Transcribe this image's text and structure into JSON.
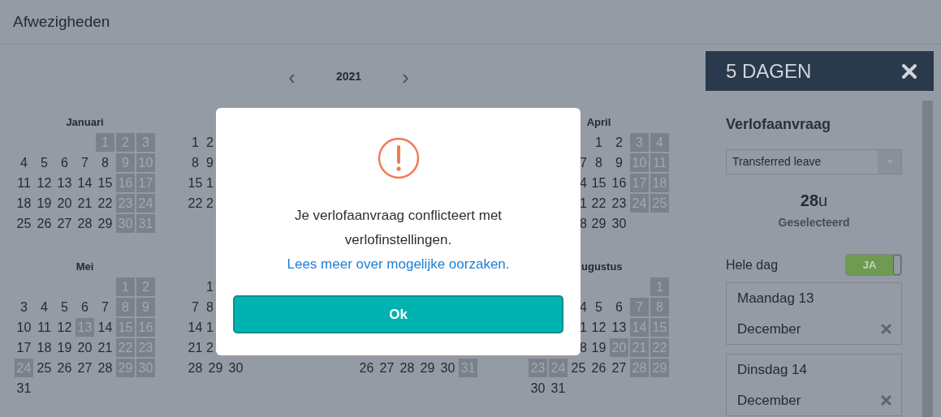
{
  "page": {
    "title": "Afwezigheden"
  },
  "year_nav": {
    "prev": "‹",
    "year": "2021",
    "next": "›"
  },
  "months": [
    {
      "title": "Januari",
      "title_cut": false,
      "weeks": [
        [
          {
            "kind": "blank"
          },
          {
            "kind": "blank"
          },
          {
            "kind": "blank"
          },
          {
            "kind": "blank"
          },
          {
            "kind": "day",
            "day": "1",
            "shaded": true
          },
          {
            "kind": "day",
            "day": "2",
            "shaded": true
          },
          {
            "kind": "day",
            "day": "3",
            "shaded": true
          }
        ],
        [
          {
            "kind": "day",
            "day": "4",
            "shaded": false
          },
          {
            "kind": "day",
            "day": "5",
            "shaded": false
          },
          {
            "kind": "day",
            "day": "6",
            "shaded": false
          },
          {
            "kind": "day",
            "day": "7",
            "shaded": false
          },
          {
            "kind": "day",
            "day": "8",
            "shaded": false
          },
          {
            "kind": "day",
            "day": "9",
            "shaded": true
          },
          {
            "kind": "day",
            "day": "10",
            "shaded": true
          }
        ],
        [
          {
            "kind": "day",
            "day": "11",
            "shaded": false
          },
          {
            "kind": "day",
            "day": "12",
            "shaded": false
          },
          {
            "kind": "day",
            "day": "13",
            "shaded": false
          },
          {
            "kind": "day",
            "day": "14",
            "shaded": false
          },
          {
            "kind": "day",
            "day": "15",
            "shaded": false
          },
          {
            "kind": "day",
            "day": "16",
            "shaded": true
          },
          {
            "kind": "day",
            "day": "17",
            "shaded": true
          }
        ],
        [
          {
            "kind": "day",
            "day": "18",
            "shaded": false
          },
          {
            "kind": "day",
            "day": "19",
            "shaded": false
          },
          {
            "kind": "day",
            "day": "20",
            "shaded": false
          },
          {
            "kind": "day",
            "day": "21",
            "shaded": false
          },
          {
            "kind": "day",
            "day": "22",
            "shaded": false
          },
          {
            "kind": "day",
            "day": "23",
            "shaded": true
          },
          {
            "kind": "day",
            "day": "24",
            "shaded": true
          }
        ],
        [
          {
            "kind": "day",
            "day": "25",
            "shaded": false
          },
          {
            "kind": "day",
            "day": "26",
            "shaded": false
          },
          {
            "kind": "day",
            "day": "27",
            "shaded": false
          },
          {
            "kind": "day",
            "day": "28",
            "shaded": false
          },
          {
            "kind": "day",
            "day": "29",
            "shaded": false
          },
          {
            "kind": "day",
            "day": "30",
            "shaded": true
          },
          {
            "kind": "day",
            "day": "31",
            "shaded": true
          }
        ]
      ]
    },
    {
      "weeks": [
        [
          {
            "kind": "day",
            "day": "1",
            "shaded": false
          },
          {
            "kind": "cut_start",
            "day": "2",
            "shaded": false
          }
        ],
        [
          {
            "kind": "day",
            "day": "8",
            "shaded": false
          },
          {
            "kind": "cut_start",
            "day": "9",
            "shaded": false
          }
        ],
        [
          {
            "kind": "day",
            "day": "15",
            "shaded": false
          },
          {
            "kind": "cut_start",
            "day": "1",
            "shaded": false
          }
        ],
        [
          {
            "kind": "day",
            "day": "22",
            "shaded": false
          },
          {
            "kind": "cut_start",
            "day": "2",
            "shaded": false
          }
        ]
      ]
    },
    {
      "kind": "covered"
    },
    {
      "title": "April",
      "title_cut": false,
      "weeks": [
        [
          {
            "kind": "blank"
          },
          {
            "kind": "blank"
          },
          {
            "kind": "blank"
          },
          {
            "kind": "day",
            "day": "1",
            "shaded": false
          },
          {
            "kind": "day",
            "day": "2",
            "shaded": false
          },
          {
            "kind": "day",
            "day": "3",
            "shaded": true
          },
          {
            "kind": "day",
            "day": "4",
            "shaded": true
          }
        ],
        [
          {
            "kind": "blank"
          },
          {
            "kind": "blank"
          },
          {
            "kind": "cut_end",
            "day": "7",
            "shaded": false
          },
          {
            "kind": "day",
            "day": "8",
            "shaded": false
          },
          {
            "kind": "day",
            "day": "9",
            "shaded": false
          },
          {
            "kind": "day",
            "day": "10",
            "shaded": true
          },
          {
            "kind": "day",
            "day": "11",
            "shaded": true
          }
        ],
        [
          {
            "kind": "blank"
          },
          {
            "kind": "blank"
          },
          {
            "kind": "cut_end",
            "day": "4",
            "shaded": false
          },
          {
            "kind": "day",
            "day": "15",
            "shaded": false
          },
          {
            "kind": "day",
            "day": "16",
            "shaded": false
          },
          {
            "kind": "day",
            "day": "17",
            "shaded": true
          },
          {
            "kind": "day",
            "day": "18",
            "shaded": true
          }
        ],
        [
          {
            "kind": "blank"
          },
          {
            "kind": "blank"
          },
          {
            "kind": "cut_end",
            "day": "1",
            "shaded": false
          },
          {
            "kind": "day",
            "day": "22",
            "shaded": false
          },
          {
            "kind": "day",
            "day": "23",
            "shaded": false
          },
          {
            "kind": "day",
            "day": "24",
            "shaded": true
          },
          {
            "kind": "day",
            "day": "25",
            "shaded": true
          }
        ],
        [
          {
            "kind": "blank"
          },
          {
            "kind": "blank"
          },
          {
            "kind": "cut_end",
            "day": "8",
            "shaded": false
          },
          {
            "kind": "day",
            "day": "29",
            "shaded": false
          },
          {
            "kind": "day",
            "day": "30",
            "shaded": false
          }
        ]
      ]
    },
    {
      "title": "Mei",
      "title_cut": false,
      "weeks": [
        [
          {
            "kind": "blank"
          },
          {
            "kind": "blank"
          },
          {
            "kind": "blank"
          },
          {
            "kind": "blank"
          },
          {
            "kind": "blank"
          },
          {
            "kind": "day",
            "day": "1",
            "shaded": true
          },
          {
            "kind": "day",
            "day": "2",
            "shaded": true
          }
        ],
        [
          {
            "kind": "day",
            "day": "3",
            "shaded": false
          },
          {
            "kind": "day",
            "day": "4",
            "shaded": false
          },
          {
            "kind": "day",
            "day": "5",
            "shaded": false
          },
          {
            "kind": "day",
            "day": "6",
            "shaded": false
          },
          {
            "kind": "day",
            "day": "7",
            "shaded": false
          },
          {
            "kind": "day",
            "day": "8",
            "shaded": true
          },
          {
            "kind": "day",
            "day": "9",
            "shaded": true
          }
        ],
        [
          {
            "kind": "day",
            "day": "10",
            "shaded": false
          },
          {
            "kind": "day",
            "day": "11",
            "shaded": false
          },
          {
            "kind": "day",
            "day": "12",
            "shaded": false
          },
          {
            "kind": "day",
            "day": "13",
            "shaded": true
          },
          {
            "kind": "day",
            "day": "14",
            "shaded": false
          },
          {
            "kind": "day",
            "day": "15",
            "shaded": true
          },
          {
            "kind": "day",
            "day": "16",
            "shaded": true
          }
        ],
        [
          {
            "kind": "day",
            "day": "17",
            "shaded": false
          },
          {
            "kind": "day",
            "day": "18",
            "shaded": false
          },
          {
            "kind": "day",
            "day": "19",
            "shaded": false
          },
          {
            "kind": "day",
            "day": "20",
            "shaded": false
          },
          {
            "kind": "day",
            "day": "21",
            "shaded": false
          },
          {
            "kind": "day",
            "day": "22",
            "shaded": true
          },
          {
            "kind": "day",
            "day": "23",
            "shaded": true
          }
        ],
        [
          {
            "kind": "day",
            "day": "24",
            "shaded": true
          },
          {
            "kind": "day",
            "day": "25",
            "shaded": false
          },
          {
            "kind": "day",
            "day": "26",
            "shaded": false
          },
          {
            "kind": "day",
            "day": "27",
            "shaded": false
          },
          {
            "kind": "day",
            "day": "28",
            "shaded": false
          },
          {
            "kind": "day",
            "day": "29",
            "shaded": true
          },
          {
            "kind": "day",
            "day": "30",
            "shaded": true
          }
        ],
        [
          {
            "kind": "day",
            "day": "31",
            "shaded": false
          }
        ]
      ]
    },
    {
      "weeks": [
        [
          {
            "kind": "blank"
          },
          {
            "kind": "cut_start",
            "day": "1",
            "shaded": false
          }
        ],
        [
          {
            "kind": "day",
            "day": "7",
            "shaded": false
          },
          {
            "kind": "cut_start",
            "day": "8",
            "shaded": false
          }
        ],
        [
          {
            "kind": "day",
            "day": "14",
            "shaded": false
          },
          {
            "kind": "cut_start",
            "day": "1",
            "shaded": false
          }
        ],
        [
          {
            "kind": "day",
            "day": "21",
            "shaded": false
          },
          {
            "kind": "cut_start",
            "day": "2",
            "shaded": false
          }
        ],
        [
          {
            "kind": "day",
            "day": "28",
            "shaded": false
          },
          {
            "kind": "day",
            "day": "29",
            "shaded": false
          },
          {
            "kind": "day",
            "day": "30",
            "shaded": false
          }
        ]
      ]
    },
    {
      "weeks": [
        [
          {
            "kind": "blank"
          }
        ],
        [
          {
            "kind": "blank"
          }
        ],
        [
          {
            "kind": "blank"
          }
        ],
        [
          {
            "kind": "blank"
          }
        ],
        [
          {
            "kind": "day",
            "day": "26",
            "shaded": false
          },
          {
            "kind": "day",
            "day": "27",
            "shaded": false
          },
          {
            "kind": "day",
            "day": "28",
            "shaded": false
          },
          {
            "kind": "day",
            "day": "29",
            "shaded": false
          },
          {
            "kind": "day",
            "day": "30",
            "shaded": false
          },
          {
            "kind": "day",
            "day": "31",
            "shaded": true
          }
        ]
      ]
    },
    {
      "title": "ugustus",
      "title_cut": true,
      "weeks": [
        [
          {
            "kind": "blank"
          },
          {
            "kind": "blank"
          },
          {
            "kind": "blank"
          },
          {
            "kind": "blank"
          },
          {
            "kind": "blank"
          },
          {
            "kind": "blank"
          },
          {
            "kind": "day",
            "day": "1",
            "shaded": true
          }
        ],
        [
          {
            "kind": "blank"
          },
          {
            "kind": "blank"
          },
          {
            "kind": "cut_end",
            "day": "4",
            "shaded": false
          },
          {
            "kind": "day",
            "day": "5",
            "shaded": false
          },
          {
            "kind": "day",
            "day": "6",
            "shaded": false
          },
          {
            "kind": "day",
            "day": "7",
            "shaded": true
          },
          {
            "kind": "day",
            "day": "8",
            "shaded": true
          }
        ],
        [
          {
            "kind": "blank"
          },
          {
            "kind": "blank"
          },
          {
            "kind": "cut_end",
            "day": "1",
            "shaded": false
          },
          {
            "kind": "day",
            "day": "12",
            "shaded": false
          },
          {
            "kind": "day",
            "day": "13",
            "shaded": false
          },
          {
            "kind": "day",
            "day": "14",
            "shaded": true
          },
          {
            "kind": "day",
            "day": "15",
            "shaded": true
          }
        ],
        [
          {
            "kind": "blank"
          },
          {
            "kind": "blank"
          },
          {
            "kind": "cut_end",
            "day": "8",
            "shaded": false
          },
          {
            "kind": "day",
            "day": "19",
            "shaded": false
          },
          {
            "kind": "day",
            "day": "20",
            "shaded": true
          },
          {
            "kind": "day",
            "day": "21",
            "shaded": true
          },
          {
            "kind": "day",
            "day": "22",
            "shaded": true
          }
        ],
        [
          {
            "kind": "day",
            "day": "23",
            "shaded": true
          },
          {
            "kind": "day",
            "day": "24",
            "shaded": true
          },
          {
            "kind": "day",
            "day": "25",
            "shaded": false
          },
          {
            "kind": "day",
            "day": "26",
            "shaded": false
          },
          {
            "kind": "day",
            "day": "27",
            "shaded": false
          },
          {
            "kind": "day",
            "day": "28",
            "shaded": true
          },
          {
            "kind": "day",
            "day": "29",
            "shaded": true
          }
        ],
        [
          {
            "kind": "day",
            "day": "30",
            "shaded": false
          },
          {
            "kind": "day",
            "day": "31",
            "shaded": false
          }
        ]
      ]
    }
  ],
  "sidebar": {
    "title": "5 DAGEN",
    "heading": "Verlofaanvraag",
    "leave_type": "Transferred leave",
    "hours": "28",
    "hours_unit": "u",
    "hours_label": "Geselecteerd",
    "full_day": {
      "label": "Hele dag",
      "on": true,
      "text": "JA"
    },
    "days": [
      {
        "day": "Maandag 13",
        "month": "December"
      },
      {
        "day": "Dinsdag 14",
        "month": "December"
      }
    ]
  },
  "modal": {
    "message": "Je verlofaanvraag conflicteert met verlofinstellingen.",
    "link": "Lees meer over mogelijke oorzaken.",
    "button": "Ok"
  }
}
